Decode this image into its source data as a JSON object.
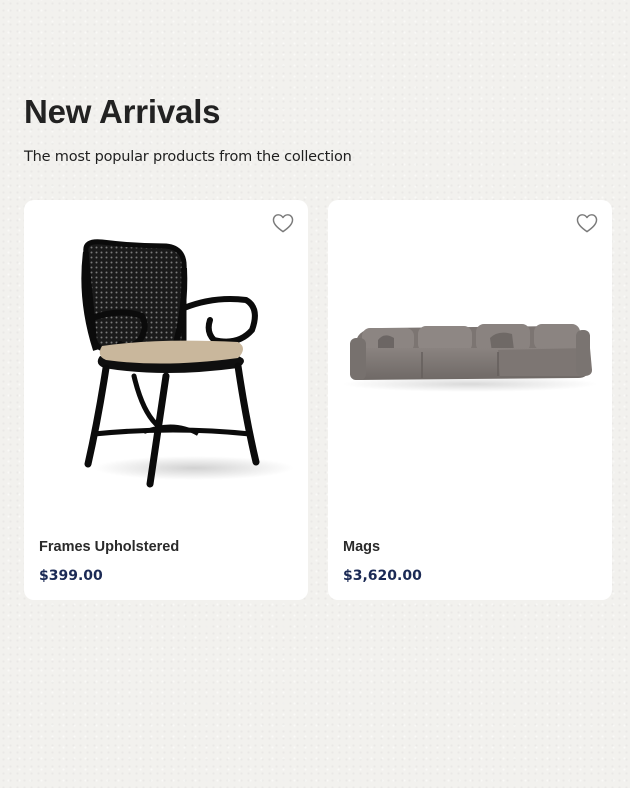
{
  "section": {
    "title": "New Arrivals",
    "subtitle": "The most popular products from the collection"
  },
  "products": [
    {
      "name": "Frames Upholstered",
      "price": "$399.00",
      "image": "black-rattan-armchair",
      "favorite_icon": "heart-outline-icon"
    },
    {
      "name": "Mags",
      "price": "$3,620.00",
      "image": "grey-sectional-sofa",
      "favorite_icon": "heart-outline-icon"
    }
  ],
  "colors": {
    "background": "#f2f1ee",
    "card": "#ffffff",
    "price": "#1b2a55",
    "heading": "#222222"
  }
}
